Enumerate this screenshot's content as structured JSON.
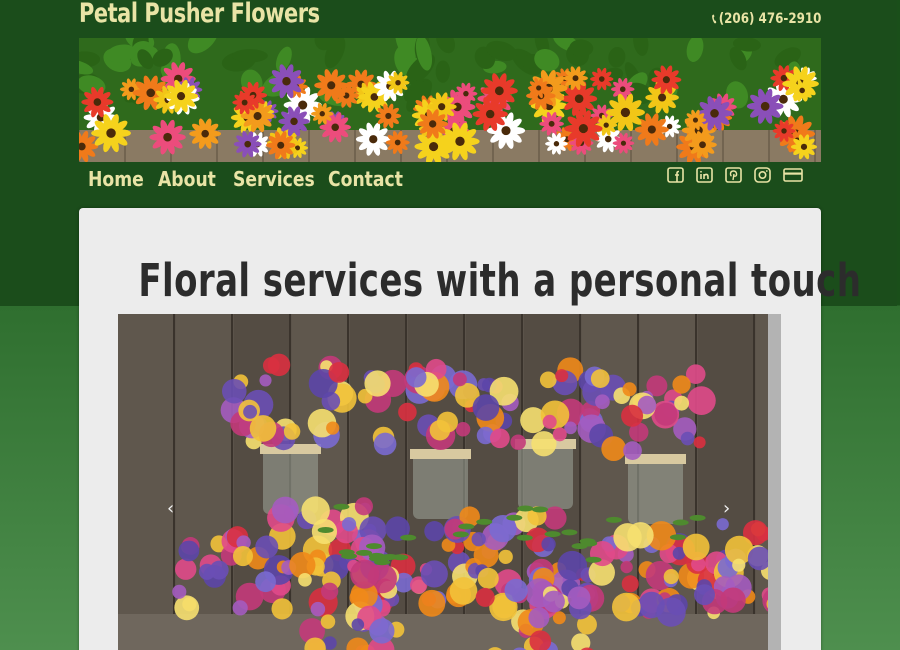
{
  "site": {
    "title": "Petal Pusher Flowers",
    "phone": "(206) 476-2910",
    "phone_icon": "phone-icon"
  },
  "nav": {
    "items": [
      {
        "label": "Home"
      },
      {
        "label": "About"
      },
      {
        "label": "Services"
      },
      {
        "label": "Contact"
      }
    ]
  },
  "social": {
    "icons": [
      "facebook-icon",
      "linkedin-icon",
      "pinterest-icon",
      "instagram-icon",
      "credit-card-icon"
    ]
  },
  "main": {
    "headline": "Floral services with a personal touch"
  },
  "carousel": {
    "prev": "‹",
    "next": "›"
  },
  "colors": {
    "header_bg": "#1b4d1b",
    "text_accent": "#e9e4a6",
    "content_bg": "#ececec",
    "headline": "#2c2c2c"
  }
}
